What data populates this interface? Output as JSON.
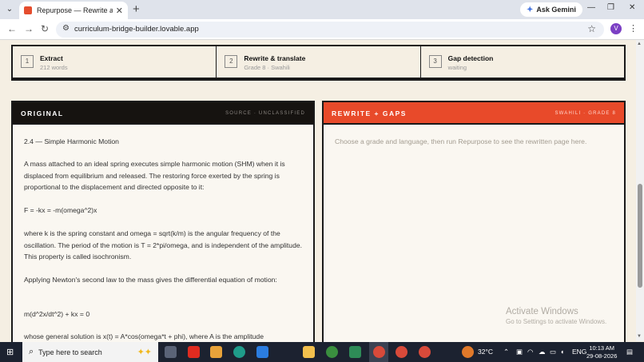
{
  "browser": {
    "tab_title": "Repurpose — Rewrite any lesso",
    "url": "curriculum-bridge-builder.lovable.app",
    "gemini_label": "Ask Gemini",
    "avatar_letter": "V"
  },
  "steps": [
    {
      "num": "1",
      "title": "Extract",
      "sub": "212 words"
    },
    {
      "num": "2",
      "title": "Rewrite & translate",
      "sub": "Grade 8 · Swahili"
    },
    {
      "num": "3",
      "title": "Gap detection",
      "sub": "waiting"
    }
  ],
  "original": {
    "title": "ORIGINAL",
    "tag": "SOURCE · UNCLASSIFIED",
    "paragraphs": [
      "2.4 — Simple Harmonic Motion",
      "A mass attached to an ideal spring executes simple harmonic motion (SHM) when it is displaced from equilibrium and released. The restoring force exerted by the spring is proportional to the displacement and directed opposite to it:",
      "F = -kx = -m(omega^2)x",
      "where k is the spring constant and omega = sqrt(k/m) is the angular frequency of the oscillation. The period of the motion is T = 2*pi/omega, and is independent of the amplitude. This property is called isochronism.",
      "Applying Newton's second law to the mass gives the differential equation of motion:",
      "m(d^2x/dt^2) + kx = 0",
      "whose general solution is x(t) = A*cos(omega*t + phi), where A is the amplitude"
    ]
  },
  "rewrite": {
    "title": "REWRITE + GAPS",
    "tag": "SWAHILI · GRADE 8",
    "placeholder": "Choose a grade and language, then run Repurpose to see the rewritten page here."
  },
  "watermark": {
    "line1": "Activate Windows",
    "line2": "Go to Settings to activate Windows."
  },
  "taskbar": {
    "search_placeholder": "Type here to search",
    "weather": "32°C",
    "lang": "ENG",
    "time": "10:13 AM",
    "date": "29-08-2026"
  }
}
